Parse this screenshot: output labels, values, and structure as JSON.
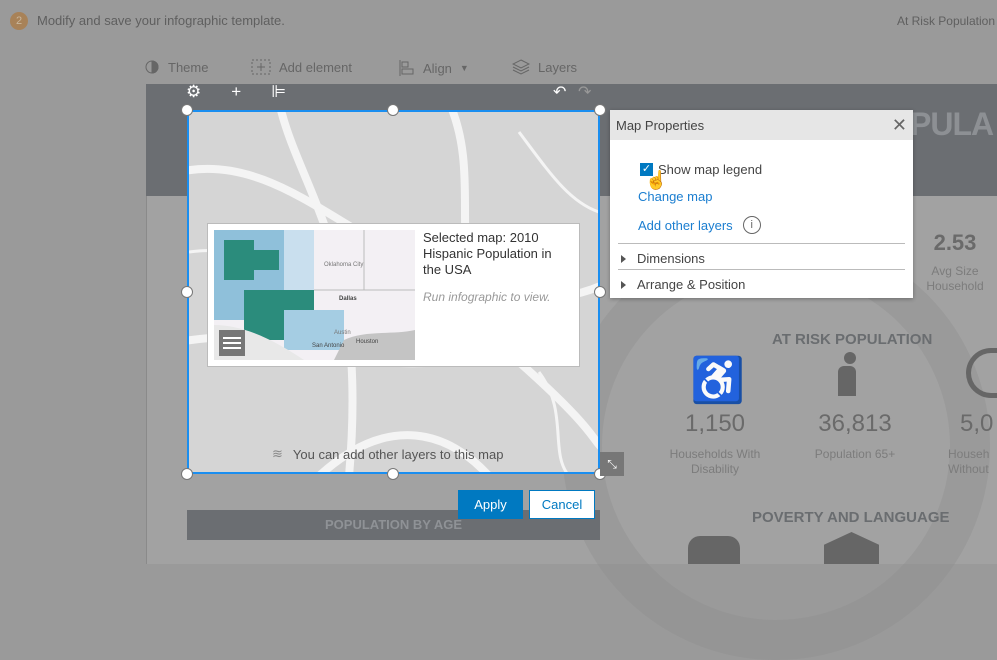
{
  "header": {
    "step": "2",
    "instruction": "Modify and save your infographic template.",
    "right_title": "At Risk Population"
  },
  "toolbar": {
    "theme": "Theme",
    "add_element": "Add element",
    "align": "Align",
    "layers": "Layers"
  },
  "infographic": {
    "title": "PULA",
    "avg_household": {
      "value": "2.53",
      "label": "Avg Size Household"
    },
    "at_risk_title": "AT RISK POPULATION",
    "stats": [
      {
        "value": "1,150",
        "label": "Households With Disability"
      },
      {
        "value": "36,813",
        "label": "Population 65+"
      },
      {
        "value": "5,0",
        "label": "Househ Without"
      }
    ],
    "poverty_title": "POVERTY AND LANGUAGE",
    "age_title": "POPULATION BY AGE"
  },
  "map": {
    "card_title": "Selected map: 2010 Hispanic Population in the USA",
    "card_note": "Run infographic to view.",
    "cities": [
      "Oklahoma City",
      "Dallas",
      "Austin",
      "San Antonio",
      "Houston"
    ],
    "layers_note": "You can add other layers to this map"
  },
  "dialog": {
    "title": "Map Properties",
    "show_legend": "Show map legend",
    "show_legend_checked": true,
    "change_map": "Change map",
    "add_layers": "Add other layers",
    "dimensions": "Dimensions",
    "arrange": "Arrange & Position"
  },
  "buttons": {
    "apply": "Apply",
    "cancel": "Cancel"
  },
  "colors": {
    "accent": "#0079c1",
    "selection": "#1a8ef0"
  }
}
